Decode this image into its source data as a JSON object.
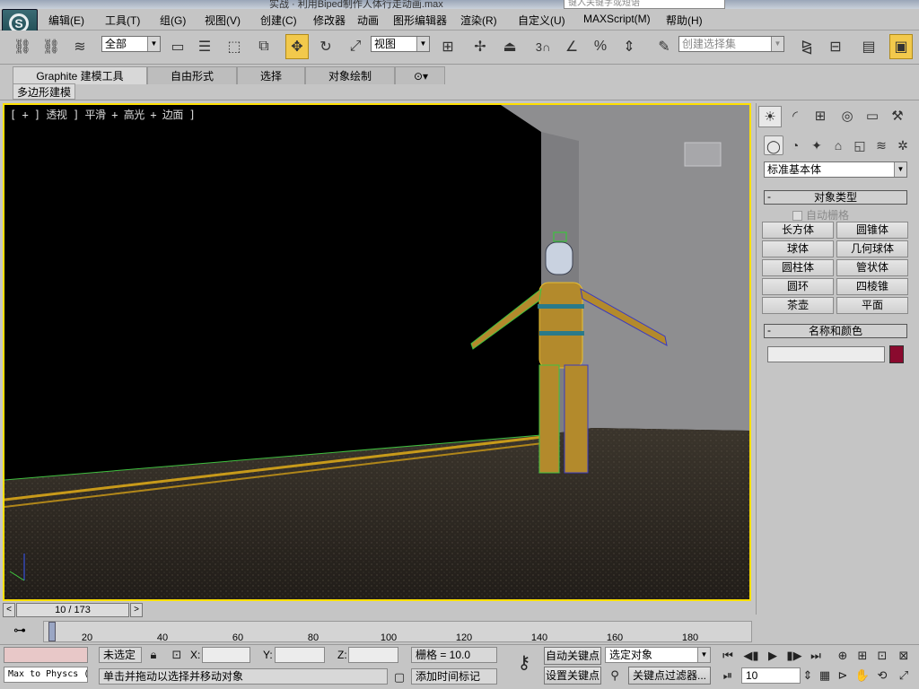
{
  "window": {
    "title": "实战 · 利用Biped制作人体行走动画.max",
    "search_placeholder": "键入关键字或短语"
  },
  "menu": {
    "items": [
      "编辑(E)",
      "工具(T)",
      "组(G)",
      "视图(V)",
      "创建(C)",
      "修改器",
      "动画",
      "图形编辑器",
      "渲染(R)",
      "自定义(U)",
      "MAXScript(M)",
      "帮助(H)"
    ]
  },
  "toolbar": {
    "selection_filter": "全部",
    "ref_coord": "视图",
    "snap_label": "3",
    "named_selection_placeholder": "创建选择集"
  },
  "ribbon": {
    "tabs": [
      "Graphite 建模工具",
      "自由形式",
      "选择",
      "对象绘制"
    ],
    "active_tab": "Graphite 建模工具",
    "sub_label": "多边形建模"
  },
  "viewport": {
    "label": "[ + ] 透视 ] 平滑 + 高光 + 边面 ]"
  },
  "command_panel": {
    "category": "标准基本体",
    "object_type_title": "对象类型",
    "autogrid_label": "自动栅格",
    "buttons": [
      "长方体",
      "圆锥体",
      "球体",
      "几何球体",
      "圆柱体",
      "管状体",
      "圆环",
      "四棱锥",
      "茶壶",
      "平面"
    ],
    "name_color_title": "名称和颜色",
    "object_color": "#8a0a2e"
  },
  "timeline": {
    "frame_display": "10 / 173",
    "ticks": [
      20,
      40,
      60,
      80,
      100,
      120,
      140,
      160,
      180
    ]
  },
  "status": {
    "script_listener": "Max to Physcs (",
    "selection_status": "未选定",
    "x_label": "X:",
    "y_label": "Y:",
    "z_label": "Z:",
    "grid": "栅格 = 10.0",
    "prompt": "单击并拖动以选择并移动对象",
    "add_time_tag": "添加时间标记",
    "auto_key": "自动关键点",
    "set_key": "设置关键点",
    "selected_dropdown": "选定对象",
    "key_filters": "关键点过滤器...",
    "current_frame": "10"
  }
}
